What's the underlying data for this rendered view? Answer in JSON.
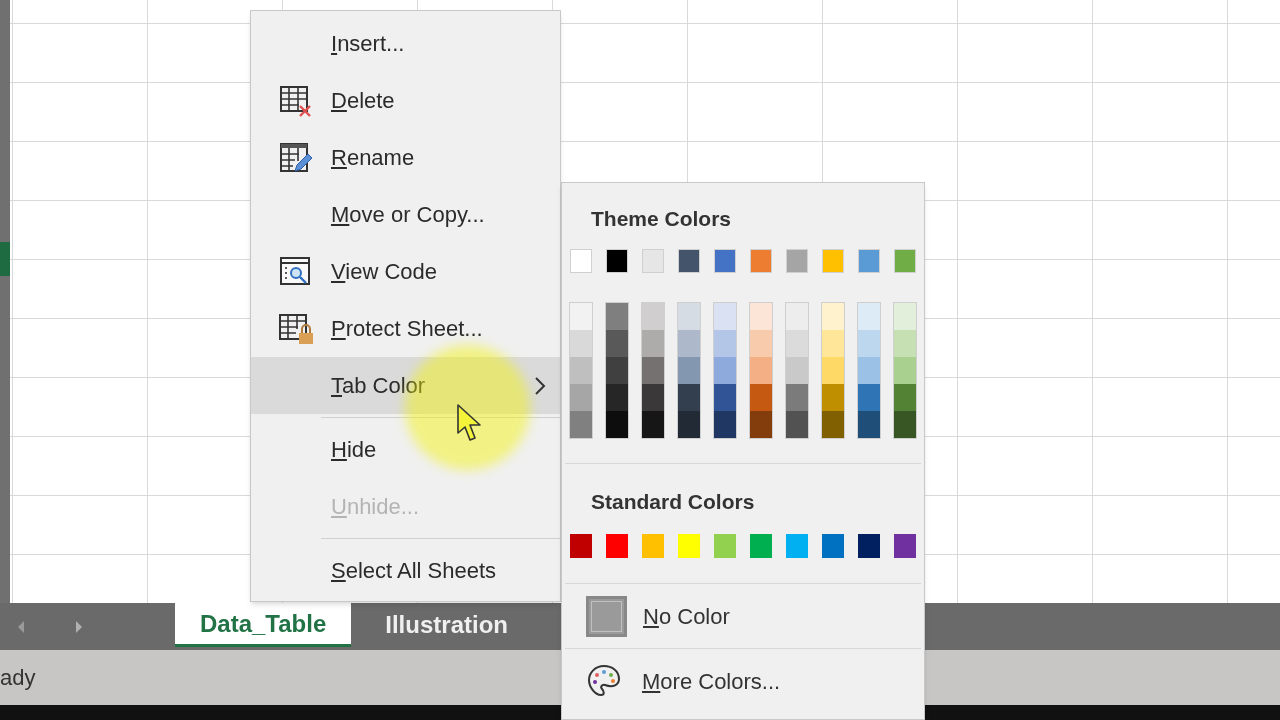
{
  "context_menu": {
    "items": [
      {
        "label": "Insert...",
        "kind": "plain",
        "disabled": false,
        "highlighted": false,
        "has_submenu": false,
        "separator_before": false
      },
      {
        "label": "Delete",
        "kind": "delete",
        "disabled": false,
        "highlighted": false,
        "has_submenu": false,
        "separator_before": false
      },
      {
        "label": "Rename",
        "kind": "rename",
        "disabled": false,
        "highlighted": false,
        "has_submenu": false,
        "separator_before": false
      },
      {
        "label": "Move or Copy...",
        "kind": "plain",
        "disabled": false,
        "highlighted": false,
        "has_submenu": false,
        "separator_before": false
      },
      {
        "label": "View Code",
        "kind": "view_code",
        "disabled": false,
        "highlighted": false,
        "has_submenu": false,
        "separator_before": false
      },
      {
        "label": "Protect Sheet...",
        "kind": "protect",
        "disabled": false,
        "highlighted": false,
        "has_submenu": false,
        "separator_before": false
      },
      {
        "label": "Tab Color",
        "kind": "plain",
        "disabled": false,
        "highlighted": true,
        "has_submenu": true,
        "separator_before": false
      },
      {
        "label": "Hide",
        "kind": "plain",
        "disabled": false,
        "highlighted": false,
        "has_submenu": false,
        "separator_before": true
      },
      {
        "label": "Unhide...",
        "kind": "plain",
        "disabled": true,
        "highlighted": false,
        "has_submenu": false,
        "separator_before": false
      },
      {
        "label": "Select All Sheets",
        "kind": "plain",
        "disabled": false,
        "highlighted": false,
        "has_submenu": false,
        "separator_before": true
      }
    ]
  },
  "color_menu": {
    "theme_title": "Theme Colors",
    "theme_colors": [
      {
        "color": "#ffffff",
        "shades": [
          {
            "color": "#f2f2f2"
          },
          {
            "color": "#d9d9d9"
          },
          {
            "color": "#bfbfbf"
          },
          {
            "color": "#a6a6a6"
          },
          {
            "color": "#808080"
          }
        ]
      },
      {
        "color": "#000000",
        "shades": [
          {
            "color": "#7f7f7f"
          },
          {
            "color": "#595959"
          },
          {
            "color": "#404040"
          },
          {
            "color": "#262626"
          },
          {
            "color": "#0d0d0d"
          }
        ]
      },
      {
        "color": "#e7e6e6",
        "shades": [
          {
            "color": "#d0cece"
          },
          {
            "color": "#aeabab"
          },
          {
            "color": "#757171"
          },
          {
            "color": "#3a3838"
          },
          {
            "color": "#171616"
          }
        ]
      },
      {
        "color": "#44546a",
        "shades": [
          {
            "color": "#d6dce4"
          },
          {
            "color": "#adb9ca"
          },
          {
            "color": "#8497b0"
          },
          {
            "color": "#333f4f"
          },
          {
            "color": "#222b35"
          }
        ]
      },
      {
        "color": "#4472c4",
        "shades": [
          {
            "color": "#d9e1f2"
          },
          {
            "color": "#b4c6e7"
          },
          {
            "color": "#8ea9db"
          },
          {
            "color": "#305496"
          },
          {
            "color": "#203764"
          }
        ]
      },
      {
        "color": "#ed7d31",
        "shades": [
          {
            "color": "#fce4d6"
          },
          {
            "color": "#f8cbad"
          },
          {
            "color": "#f4b084"
          },
          {
            "color": "#c65911"
          },
          {
            "color": "#833c0c"
          }
        ]
      },
      {
        "color": "#a5a5a5",
        "shades": [
          {
            "color": "#ededed"
          },
          {
            "color": "#dbdbdb"
          },
          {
            "color": "#c9c9c9"
          },
          {
            "color": "#7b7b7b"
          },
          {
            "color": "#525252"
          }
        ]
      },
      {
        "color": "#ffc000",
        "shades": [
          {
            "color": "#fff2cc"
          },
          {
            "color": "#ffe699"
          },
          {
            "color": "#ffd966"
          },
          {
            "color": "#bf8f00"
          },
          {
            "color": "#806000"
          }
        ]
      },
      {
        "color": "#5b9bd5",
        "shades": [
          {
            "color": "#ddebf7"
          },
          {
            "color": "#bdd7ee"
          },
          {
            "color": "#9bc2e6"
          },
          {
            "color": "#2f75b5"
          },
          {
            "color": "#1f4e78"
          }
        ]
      },
      {
        "color": "#70ad47",
        "shades": [
          {
            "color": "#e2efda"
          },
          {
            "color": "#c6e0b4"
          },
          {
            "color": "#a9d08e"
          },
          {
            "color": "#548235"
          },
          {
            "color": "#375623"
          }
        ]
      }
    ],
    "standard_title": "Standard Colors",
    "standard_colors": [
      {
        "color": "#c00000"
      },
      {
        "color": "#ff0000"
      },
      {
        "color": "#ffc000"
      },
      {
        "color": "#ffff00"
      },
      {
        "color": "#92d050"
      },
      {
        "color": "#00b050"
      },
      {
        "color": "#00b0f0"
      },
      {
        "color": "#0070c0"
      },
      {
        "color": "#002060"
      },
      {
        "color": "#7030a0"
      }
    ],
    "no_color": "No Color",
    "more_colors": "More Colors..."
  },
  "sheet_tabs": [
    {
      "label": "Data_Table",
      "selected": true
    },
    {
      "label": "Illustration",
      "selected": false
    }
  ],
  "status_bar": {
    "text": "ady"
  }
}
